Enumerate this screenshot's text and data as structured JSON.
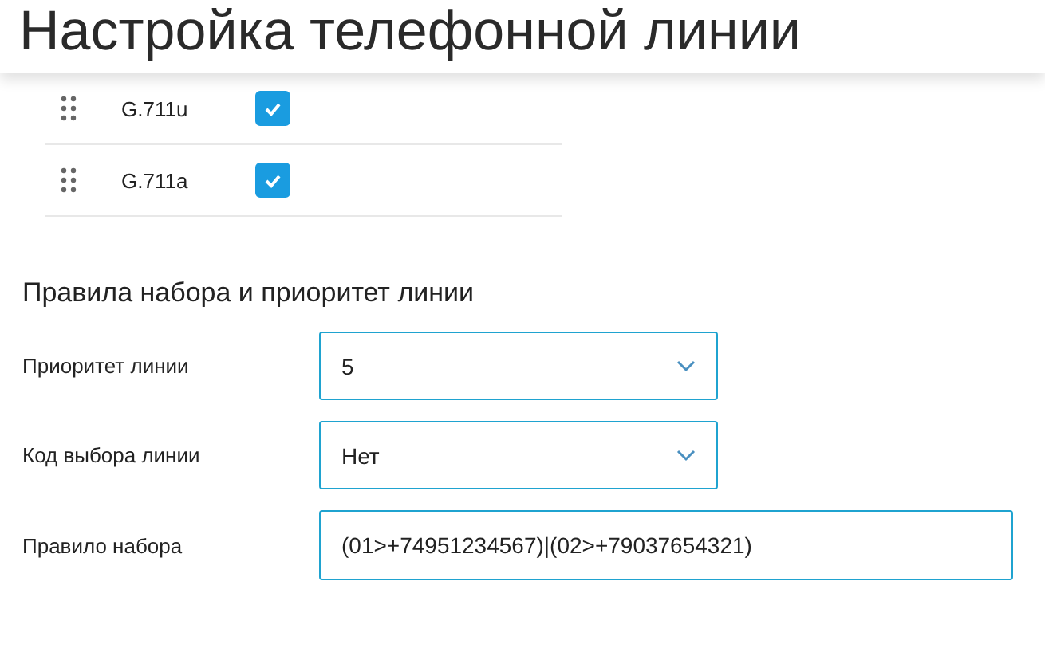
{
  "header": {
    "title": "Настройка телефонной линии"
  },
  "codecs": [
    {
      "name": "G.711u",
      "checked": true
    },
    {
      "name": "G.711a",
      "checked": true
    }
  ],
  "dial_rules": {
    "heading": "Правила набора и приоритет линии",
    "fields": [
      {
        "kind": "select",
        "label": "Приоритет линии",
        "value": "5"
      },
      {
        "kind": "select",
        "label": "Код выбора линии",
        "value": "Нет"
      },
      {
        "kind": "text",
        "label": "Правило набора",
        "value": "(01>+74951234567)|(02>+79037654321)"
      }
    ]
  }
}
